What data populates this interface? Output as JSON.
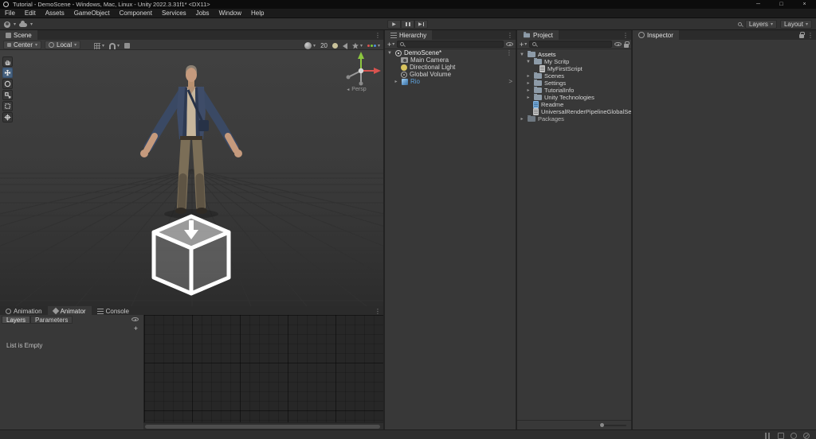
{
  "title_bar": {
    "title": "Tutorial - DemoScene - Windows, Mac, Linux - Unity 2022.3.31f1* <DX11>"
  },
  "menu": {
    "items": [
      "File",
      "Edit",
      "Assets",
      "GameObject",
      "Component",
      "Services",
      "Jobs",
      "Window",
      "Help"
    ]
  },
  "toolbar": {
    "layers_label": "Layers",
    "layout_label": "Layout"
  },
  "icons": {
    "dropdown": "▾",
    "more": "⋮",
    "expand_open": "▼",
    "expand_closed": "▸",
    "play": "▶",
    "plus": "+",
    "minimize": "─",
    "maximize": "□",
    "close": "×",
    "back_arrow": "◄",
    "prefab_arrow": ">"
  },
  "scene_panel": {
    "tab": "Scene",
    "pivot_button": "Center",
    "orientation_button": "Local",
    "camera_value": "20",
    "projection_label": "Persp"
  },
  "hierarchy_panel": {
    "tab": "Hierarchy",
    "scene_row": "DemoScene*",
    "items": [
      {
        "label": "Main Camera"
      },
      {
        "label": "Directional Light"
      },
      {
        "label": "Global Volume"
      },
      {
        "label": "Rio"
      }
    ]
  },
  "project_panel": {
    "tab": "Project",
    "rows": [
      {
        "label": "Assets"
      },
      {
        "label": "My Scritp"
      },
      {
        "label": "MyFirstScript"
      },
      {
        "label": "Scenes"
      },
      {
        "label": "Settings"
      },
      {
        "label": "TutorialInfo"
      },
      {
        "label": "Unity Technologies"
      },
      {
        "label": "Readme"
      },
      {
        "label": "UniversalRenderPipelineGlobalSettings"
      },
      {
        "label": "Packages"
      }
    ]
  },
  "inspector_panel": {
    "tab": "Inspector"
  },
  "animator_panel": {
    "tabs": [
      {
        "label": "Animation"
      },
      {
        "label": "Animator"
      },
      {
        "label": "Console"
      }
    ],
    "layers_button": "Layers",
    "parameters_button": "Parameters",
    "empty_message": "List is Empty"
  },
  "colors": {
    "prefab_text": "#5fa3dd",
    "axis_x": "#d9534f",
    "axis_y": "#8cc63f",
    "axis_z": "#4f8edc"
  }
}
